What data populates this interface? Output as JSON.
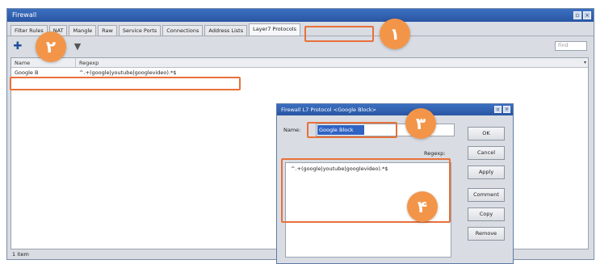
{
  "window": {
    "title": "Firewall",
    "status": "1 item"
  },
  "tabs": [
    {
      "label": "Filter Rules"
    },
    {
      "label": "NAT"
    },
    {
      "label": "Mangle"
    },
    {
      "label": "Raw"
    },
    {
      "label": "Service Ports"
    },
    {
      "label": "Connections"
    },
    {
      "label": "Address Lists"
    },
    {
      "label": "Layer7 Protocols",
      "active": true
    }
  ],
  "toolbar": {
    "add_icon": "plus-icon",
    "filter_icon": "filter-icon",
    "find_placeholder": "Find"
  },
  "list": {
    "columns": [
      "Name",
      "Regexp"
    ],
    "rows": [
      {
        "name": "Google B",
        "regexp": "^.+(google|youtube|googlevideo).*$"
      }
    ]
  },
  "dialog": {
    "title": "Firewall L7 Protocol <Google Block>",
    "name_label": "Name:",
    "name_value": "Google Block",
    "regexp_label": "Regexp:",
    "regexp_value": "^.+(google|youtube|googlevideo).*$",
    "buttons": [
      "OK",
      "Cancel",
      "Apply",
      "Comment",
      "Copy",
      "Remove"
    ]
  },
  "annotations": [
    "۱",
    "۲",
    "۳",
    "۴"
  ],
  "colors": {
    "highlight": "#e8703b",
    "badge": "#f39549",
    "titlebar": "#2a56a3"
  }
}
